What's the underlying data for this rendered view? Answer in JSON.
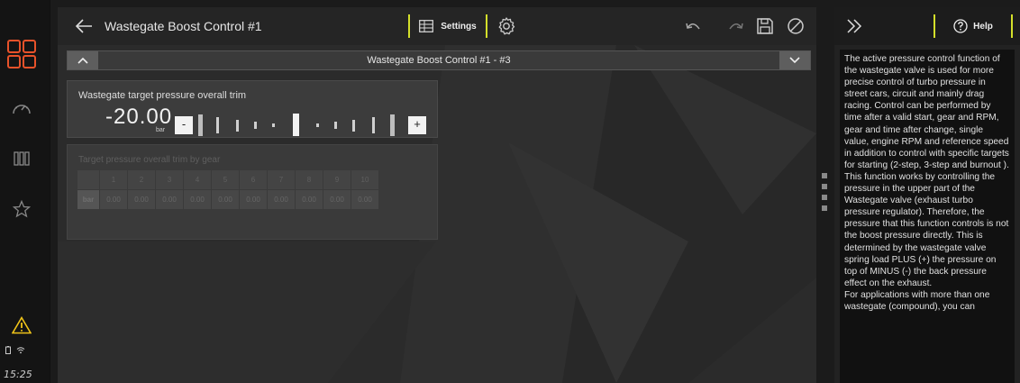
{
  "sidebar": {
    "items": [
      {
        "icon": "grid-icon"
      },
      {
        "icon": "gauge-icon"
      },
      {
        "icon": "columns-icon"
      },
      {
        "icon": "star-icon"
      },
      {
        "icon": "warning-icon"
      }
    ],
    "time": "15:25",
    "accent": "#e8522a"
  },
  "header": {
    "title": "Wastegate Boost Control #1",
    "settings_label": "Settings"
  },
  "section": {
    "title": "Wastegate Boost Control #1 - #3"
  },
  "trim": {
    "label": "Wastegate target pressure overall trim",
    "value": "-20.00",
    "unit": "bar",
    "minus": "-",
    "plus": "+"
  },
  "gear_table": {
    "label": "Target pressure overall trim by gear",
    "row_label": "bar",
    "headers": [
      "1",
      "2",
      "3",
      "4",
      "5",
      "6",
      "7",
      "8",
      "9",
      "10"
    ],
    "values": [
      "0.00",
      "0.00",
      "0.00",
      "0.00",
      "0.00",
      "0.00",
      "0.00",
      "0.00",
      "0.00",
      "0.00"
    ]
  },
  "help": {
    "button_label": "Help",
    "text": "The active pressure control function of the wastegate valve is used for more precise control of turbo pressure in street cars, circuit and mainly drag racing. Control can be performed by time after a valid start, gear and RPM, gear and time after change, single value, engine RPM and reference speed in addition to control with specific targets for starting (2-step, 3-step and burnout ).\nThis function works by controlling the pressure in the upper part of the Wastegate valve (exhaust turbo pressure regulator). Therefore, the pressure that this function controls is not the boost pressure directly. This is determined by the wastegate valve spring load PLUS (+) the pressure on top of MINUS (-) the back pressure effect on the exhaust.\nFor applications with more than one wastegate (compound), you can"
  },
  "colors": {
    "accent_yellow": "#d4df2a",
    "brand_orange": "#e8522a",
    "warning_yellow": "#f0c419"
  }
}
